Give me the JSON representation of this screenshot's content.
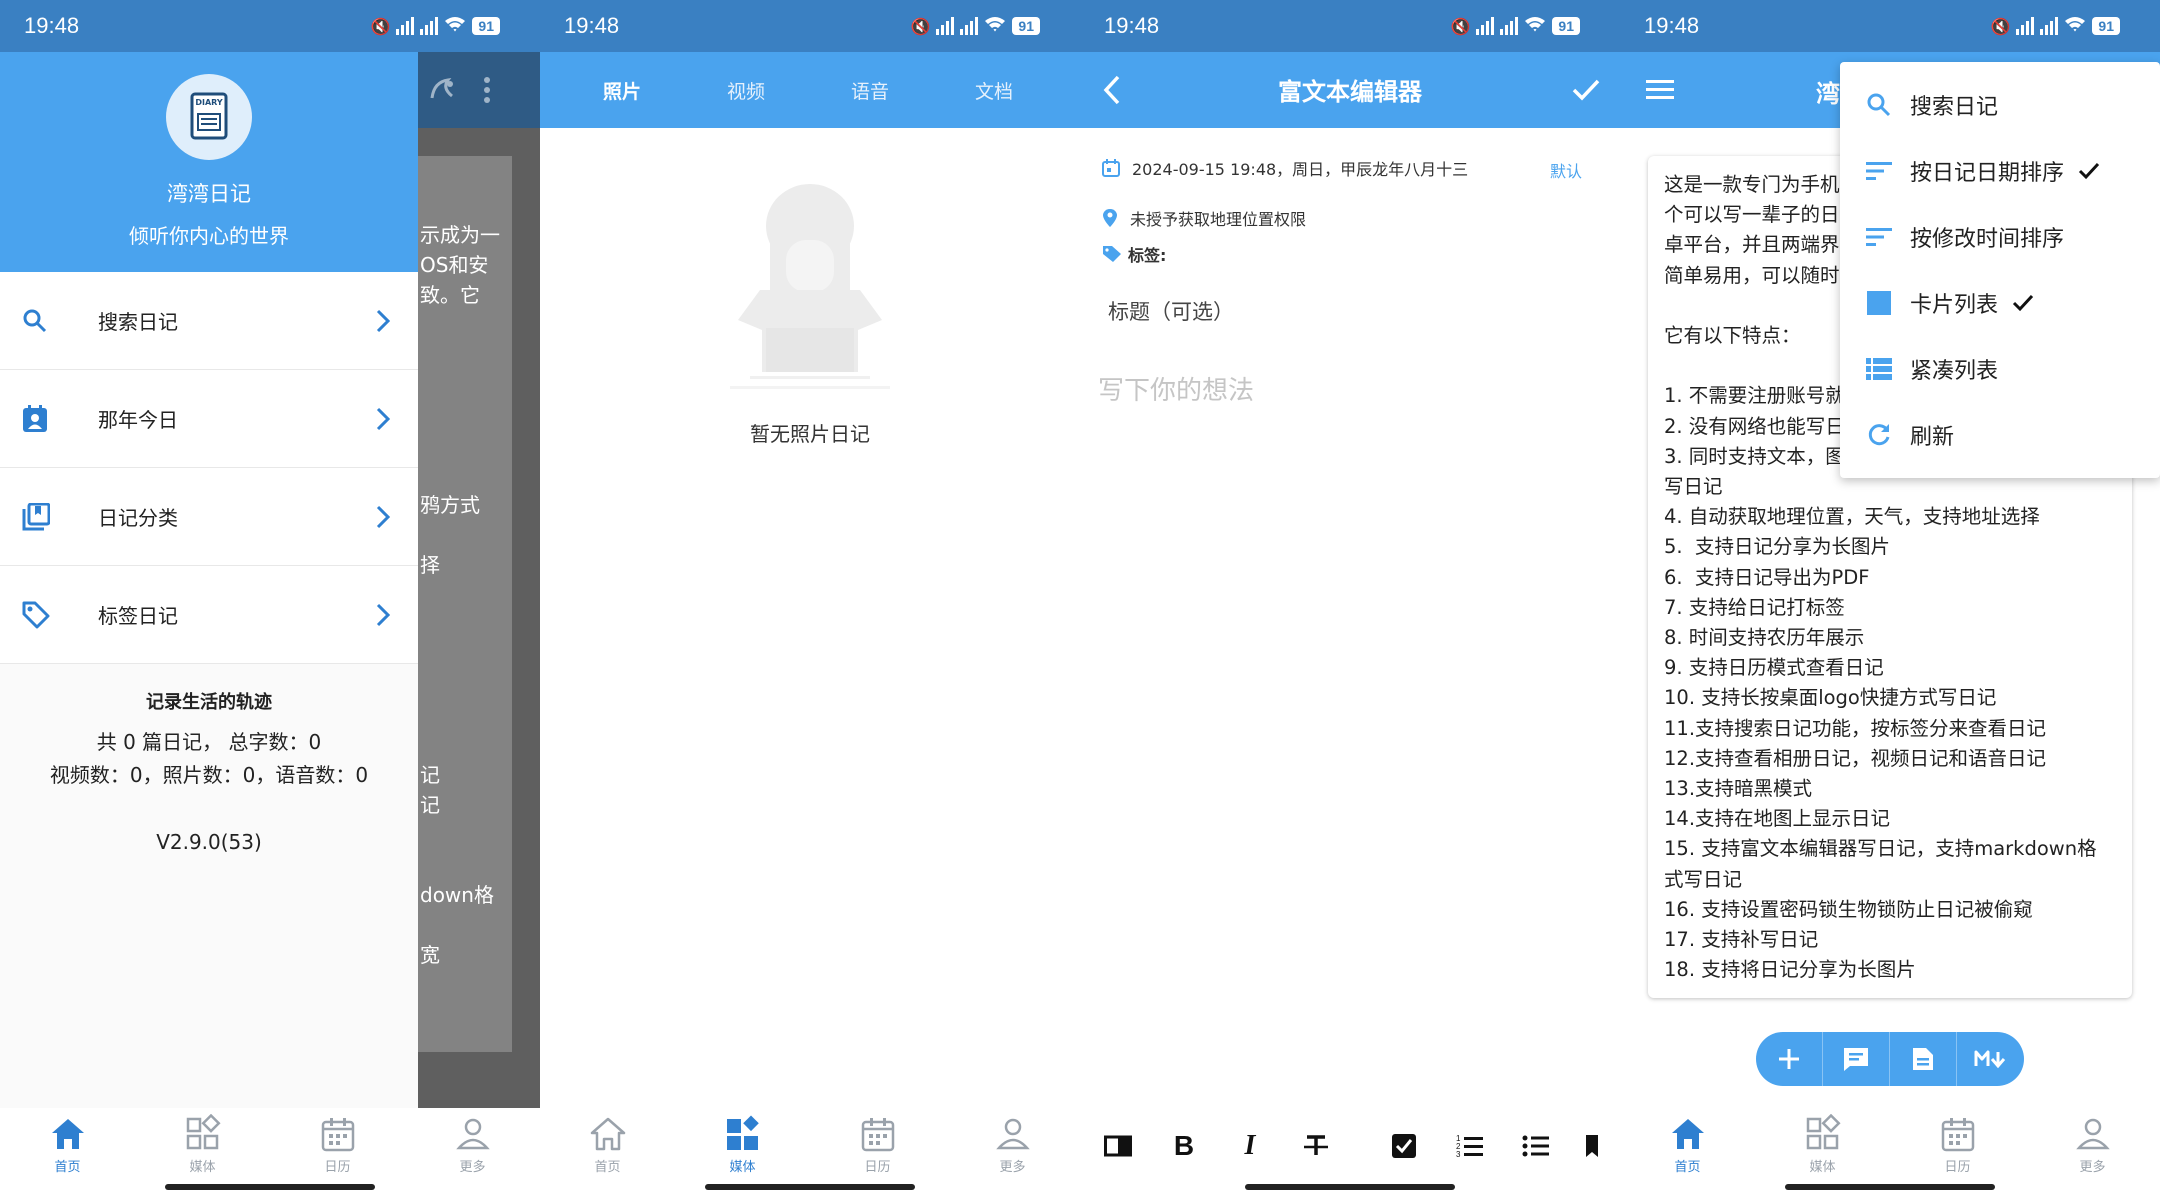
{
  "status": {
    "time": "19:48",
    "battery": "91"
  },
  "nav": {
    "home": "首页",
    "media": "媒体",
    "calendar": "日历",
    "more": "更多"
  },
  "panel1": {
    "logo_text": "DIARY",
    "app_name": "湾湾日记",
    "slogan": "倾听你内心的世界",
    "menu": [
      {
        "label": "搜索日记",
        "icon": "search-icon"
      },
      {
        "label": "那年今日",
        "icon": "contact-calendar-icon"
      },
      {
        "label": "日记分类",
        "icon": "book-category-icon"
      },
      {
        "label": "标签日记",
        "icon": "tag-icon"
      }
    ],
    "stats_title": "记录生活的轨迹",
    "stats_line1": "共 0 篇日记， 总字数：0",
    "stats_line2": "视频数：0，照片数：0，语音数：0",
    "version": "V2.9.0(53)",
    "behind_text": "示成为一\nOS和安\n致。它\n\n\n\n\n\n\n鸦方式\n\n择\n\n\n\n\n\n\n记\n记\n\n\ndown格\n\n宽"
  },
  "panel2": {
    "tabs": [
      "照片",
      "视频",
      "语音",
      "文档"
    ],
    "empty_label": "暂无照片日记"
  },
  "panel3": {
    "title": "富文本编辑器",
    "date_line": "2024-09-15 19:48，周日，甲辰龙年八月十三",
    "default_label": "默认",
    "location": "未授予获取地理位置权限",
    "tags_label": "标签:",
    "title_placeholder": "标题（可选）",
    "body_placeholder": "写下你的想法",
    "toolbar": [
      "split-view-icon",
      "bold-icon",
      "italic-icon",
      "strikethrough-icon",
      "checkbox-icon",
      "ordered-list-icon",
      "bullet-list-icon",
      "bookmark-icon"
    ]
  },
  "panel4": {
    "appbar_title": "湾",
    "note_text": "这是一款专门为手机\n个可以写一辈子的日\n卓平台，并且两端界\n简单易用，可以随时\n\n它有以下特点：\n\n1. 不需要注册账号就\n2. 没有网络也能写日\n3. 同时支持文本，图\n写日记\n4. 自动获取地理位置，天气，支持地址选择\n5.  支持日记分享为长图片\n6.  支持日记导出为PDF\n7. 支持给日记打标签\n8. 时间支持农历年展示\n9. 支持日历模式查看日记\n10. 支持长按桌面logo快捷方式写日记\n11.支持搜索日记功能，按标签分来查看日记\n12.支持查看相册日记，视频日记和语音日记\n13.支持暗黑模式\n14.支持在地图上显示日记\n15. 支持富文本编辑器写日记，支持markdown格\n式写日记\n16. 支持设置密码锁生物锁防止日记被偷窥\n17. 支持补写日记\n18. 支持将日记分享为长图片",
    "popup": [
      {
        "label": "搜索日记",
        "icon": "search-icon",
        "checked": false
      },
      {
        "label": "按日记日期排序",
        "icon": "sort-icon",
        "checked": true
      },
      {
        "label": "按修改时间排序",
        "icon": "sort-icon",
        "checked": false
      },
      {
        "label": "卡片列表",
        "icon": "card-view-icon",
        "checked": true
      },
      {
        "label": "紧凑列表",
        "icon": "compact-list-icon",
        "checked": false
      },
      {
        "label": "刷新",
        "icon": "refresh-icon",
        "checked": false
      }
    ],
    "fab": [
      "add-icon",
      "chat-note-icon",
      "document-icon",
      "markdown-icon"
    ]
  },
  "colors": {
    "statusbar": "#3a80c2",
    "appbar": "#4aa3ee",
    "accent": "#2e7fd0"
  }
}
